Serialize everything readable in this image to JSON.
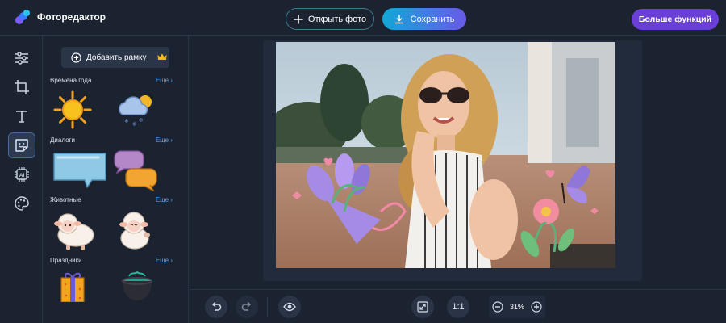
{
  "app": {
    "title": "Фоторедактор"
  },
  "header": {
    "open_label": "Открыть фото",
    "save_label": "Сохранить",
    "more_label": "Больше функций"
  },
  "tools": [
    {
      "name": "adjust-tool",
      "icon": "sliders-icon"
    },
    {
      "name": "crop-tool",
      "icon": "crop-icon"
    },
    {
      "name": "text-tool",
      "icon": "text-icon"
    },
    {
      "name": "sticker-tool",
      "icon": "sticker-icon",
      "active": true
    },
    {
      "name": "ai-tool",
      "icon": "ai-chip-icon"
    },
    {
      "name": "filters-tool",
      "icon": "palette-icon"
    }
  ],
  "panel": {
    "add_frame_label": "Добавить рамку",
    "categories": [
      {
        "name": "Времена года",
        "more": "Еще",
        "stickers": [
          "sun-sticker",
          "snow-cloud-sticker"
        ]
      },
      {
        "name": "Диалоги",
        "more": "Еще",
        "stickers": [
          "speech-bubble-sticker",
          "chat-bubbles-sticker"
        ]
      },
      {
        "name": "Животные",
        "more": "Еще",
        "stickers": [
          "sheep-sticker",
          "sheep-waving-sticker"
        ]
      },
      {
        "name": "Праздники",
        "more": "Еще",
        "stickers": [
          "gift-sticker",
          "cauldron-sticker"
        ]
      }
    ]
  },
  "bottom": {
    "ratio_label": "1:1",
    "zoom_value": "31%"
  },
  "colors": {
    "background": "#1b2331",
    "accent_blue": "#11a8d6",
    "accent_purple": "#6a3fd8",
    "link": "#4aa7ff"
  }
}
